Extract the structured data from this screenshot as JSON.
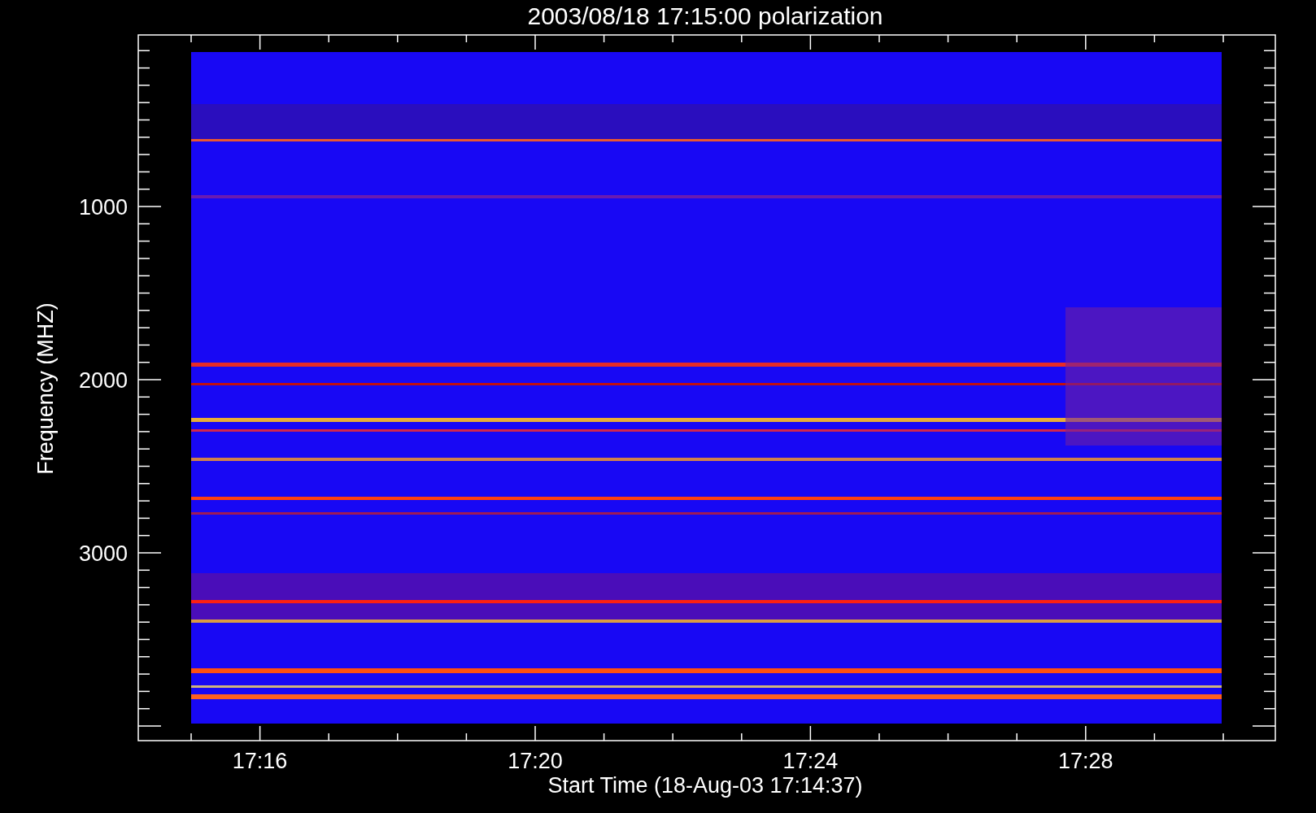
{
  "title": "2003/08/18 17:15:00 polarization",
  "x_axis": {
    "label": "Start Time (18-Aug-03 17:14:37)",
    "ticks": [
      "17:16",
      "17:20",
      "17:24",
      "17:28"
    ]
  },
  "y_axis": {
    "label": "Frequency (MHZ)",
    "ticks": [
      "1000",
      "2000",
      "3000"
    ]
  }
}
